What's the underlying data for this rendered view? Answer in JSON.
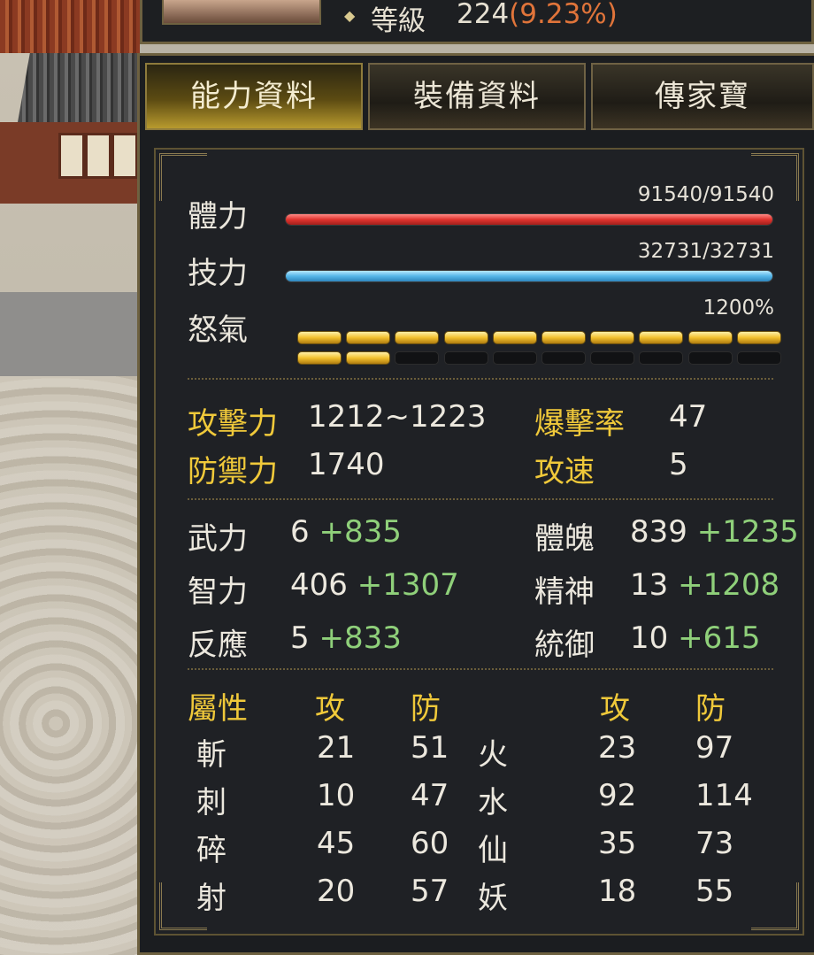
{
  "level": {
    "label": "等級",
    "value": "224",
    "percent": "(9.23%)"
  },
  "tabs": [
    {
      "label": "能力資料",
      "active": true
    },
    {
      "label": "裝備資料",
      "active": false
    },
    {
      "label": "傳家寶",
      "active": false
    }
  ],
  "bars": {
    "hp": {
      "label": "體力",
      "value": "91540/91540",
      "fraction": 1.0
    },
    "mp": {
      "label": "技力",
      "value": "32731/32731",
      "fraction": 1.0
    },
    "rage": {
      "label": "怒氣",
      "value": "1200%",
      "segments_total": 20,
      "segments_filled": 12
    }
  },
  "combat": {
    "attack": {
      "label": "攻擊力",
      "value": "1212~1223"
    },
    "defense": {
      "label": "防禦力",
      "value": "1740"
    },
    "crit": {
      "label": "爆擊率",
      "value": "47"
    },
    "speed": {
      "label": "攻速",
      "value": "5"
    }
  },
  "attributes": [
    {
      "label": "武力",
      "base": "6",
      "bonus": "+835"
    },
    {
      "label": "體魄",
      "base": "839",
      "bonus": "+1235"
    },
    {
      "label": "智力",
      "base": "406",
      "bonus": "+1307"
    },
    {
      "label": "精神",
      "base": "13",
      "bonus": "+1208"
    },
    {
      "label": "反應",
      "base": "5",
      "bonus": "+833"
    },
    {
      "label": "統御",
      "base": "10",
      "bonus": "+615"
    }
  ],
  "elements": {
    "header": {
      "title": "屬性",
      "atk": "攻",
      "def": "防",
      "atk2": "攻",
      "def2": "防"
    },
    "rows": [
      {
        "a": "斬",
        "a_atk": "21",
        "a_def": "51",
        "b": "火",
        "b_atk": "23",
        "b_def": "97"
      },
      {
        "a": "刺",
        "a_atk": "10",
        "a_def": "47",
        "b": "水",
        "b_atk": "92",
        "b_def": "114"
      },
      {
        "a": "碎",
        "a_atk": "45",
        "a_def": "60",
        "b": "仙",
        "b_atk": "35",
        "b_def": "73"
      },
      {
        "a": "射",
        "a_atk": "20",
        "a_def": "57",
        "b": "妖",
        "b_atk": "18",
        "b_def": "55"
      }
    ]
  },
  "colors": {
    "accent_gold": "#f0c93a",
    "bonus_green": "#8fd07a",
    "level_pct": "#e0743a",
    "hp_red": "#e0342f",
    "mp_blue": "#55b6e8"
  }
}
